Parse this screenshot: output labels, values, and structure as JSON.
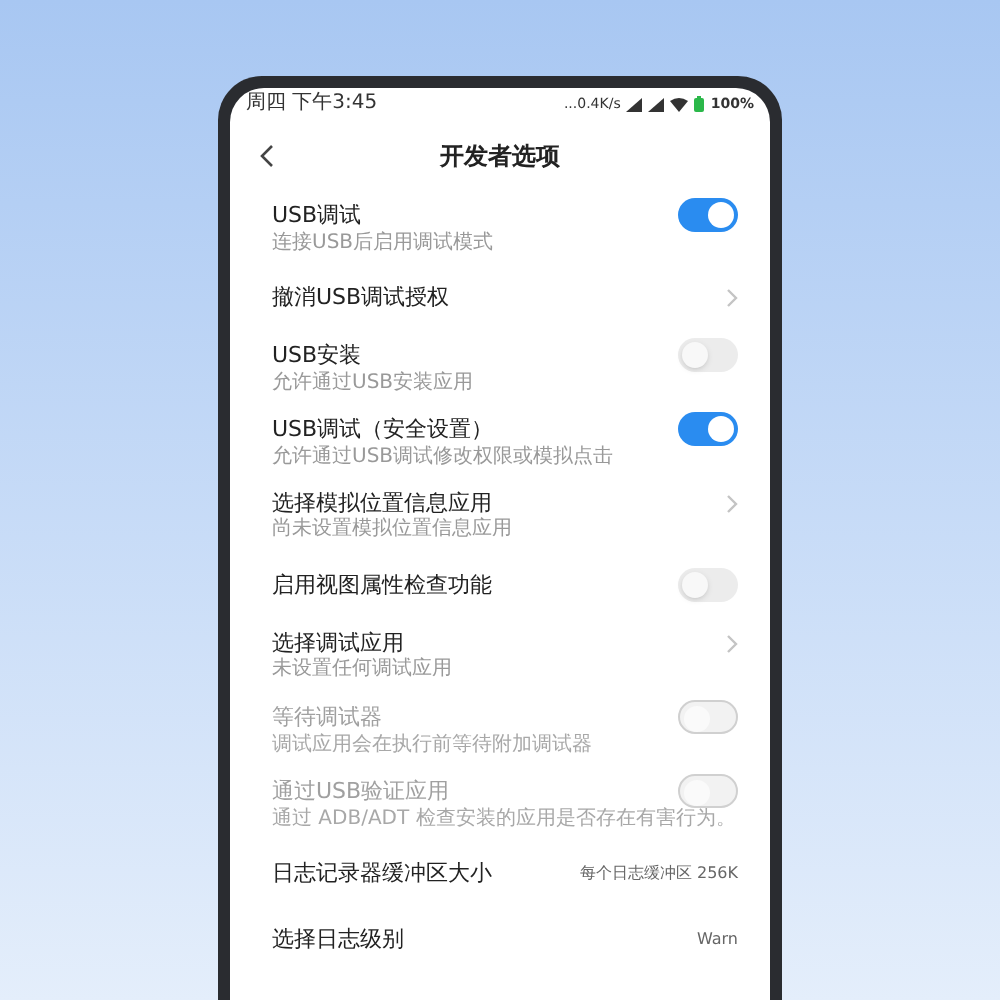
{
  "status_bar": {
    "left": "周四 下午3:45",
    "speed": "...0.4K/s",
    "battery": "100%"
  },
  "header": {
    "title": "开发者选项"
  },
  "items": [
    {
      "kind": "toggle",
      "title": "USB调试",
      "subtitle": "连接USB后启用调试模式",
      "on": true,
      "disabled": false
    },
    {
      "kind": "link",
      "title": "撤消USB调试授权",
      "disabled": false
    },
    {
      "kind": "toggle",
      "title": "USB安装",
      "subtitle": "允许通过USB安装应用",
      "on": false,
      "disabled": false
    },
    {
      "kind": "toggle",
      "title": "USB调试（安全设置）",
      "subtitle": "允许通过USB调试修改权限或模拟点击",
      "on": true,
      "disabled": false
    },
    {
      "kind": "link",
      "title": "选择模拟位置信息应用",
      "subtitle": "尚未设置模拟位置信息应用",
      "disabled": false
    },
    {
      "kind": "toggle",
      "title": "启用视图属性检查功能",
      "on": false,
      "disabled": false
    },
    {
      "kind": "link",
      "title": "选择调试应用",
      "subtitle": "未设置任何调试应用",
      "disabled": false
    },
    {
      "kind": "toggle",
      "title": "等待调试器",
      "subtitle": "调试应用会在执行前等待附加调试器",
      "on": false,
      "disabled": true
    },
    {
      "kind": "toggle",
      "title": "通过USB验证应用",
      "subtitle": "通过 ADB/ADT 检查安装的应用是否存在有害行为。",
      "on": false,
      "disabled": true
    },
    {
      "kind": "value",
      "title": "日志记录器缓冲区大小",
      "value": "每个日志缓冲区 256K",
      "disabled": false
    },
    {
      "kind": "value",
      "title": "选择日志级别",
      "value": "Warn",
      "disabled": false
    }
  ]
}
